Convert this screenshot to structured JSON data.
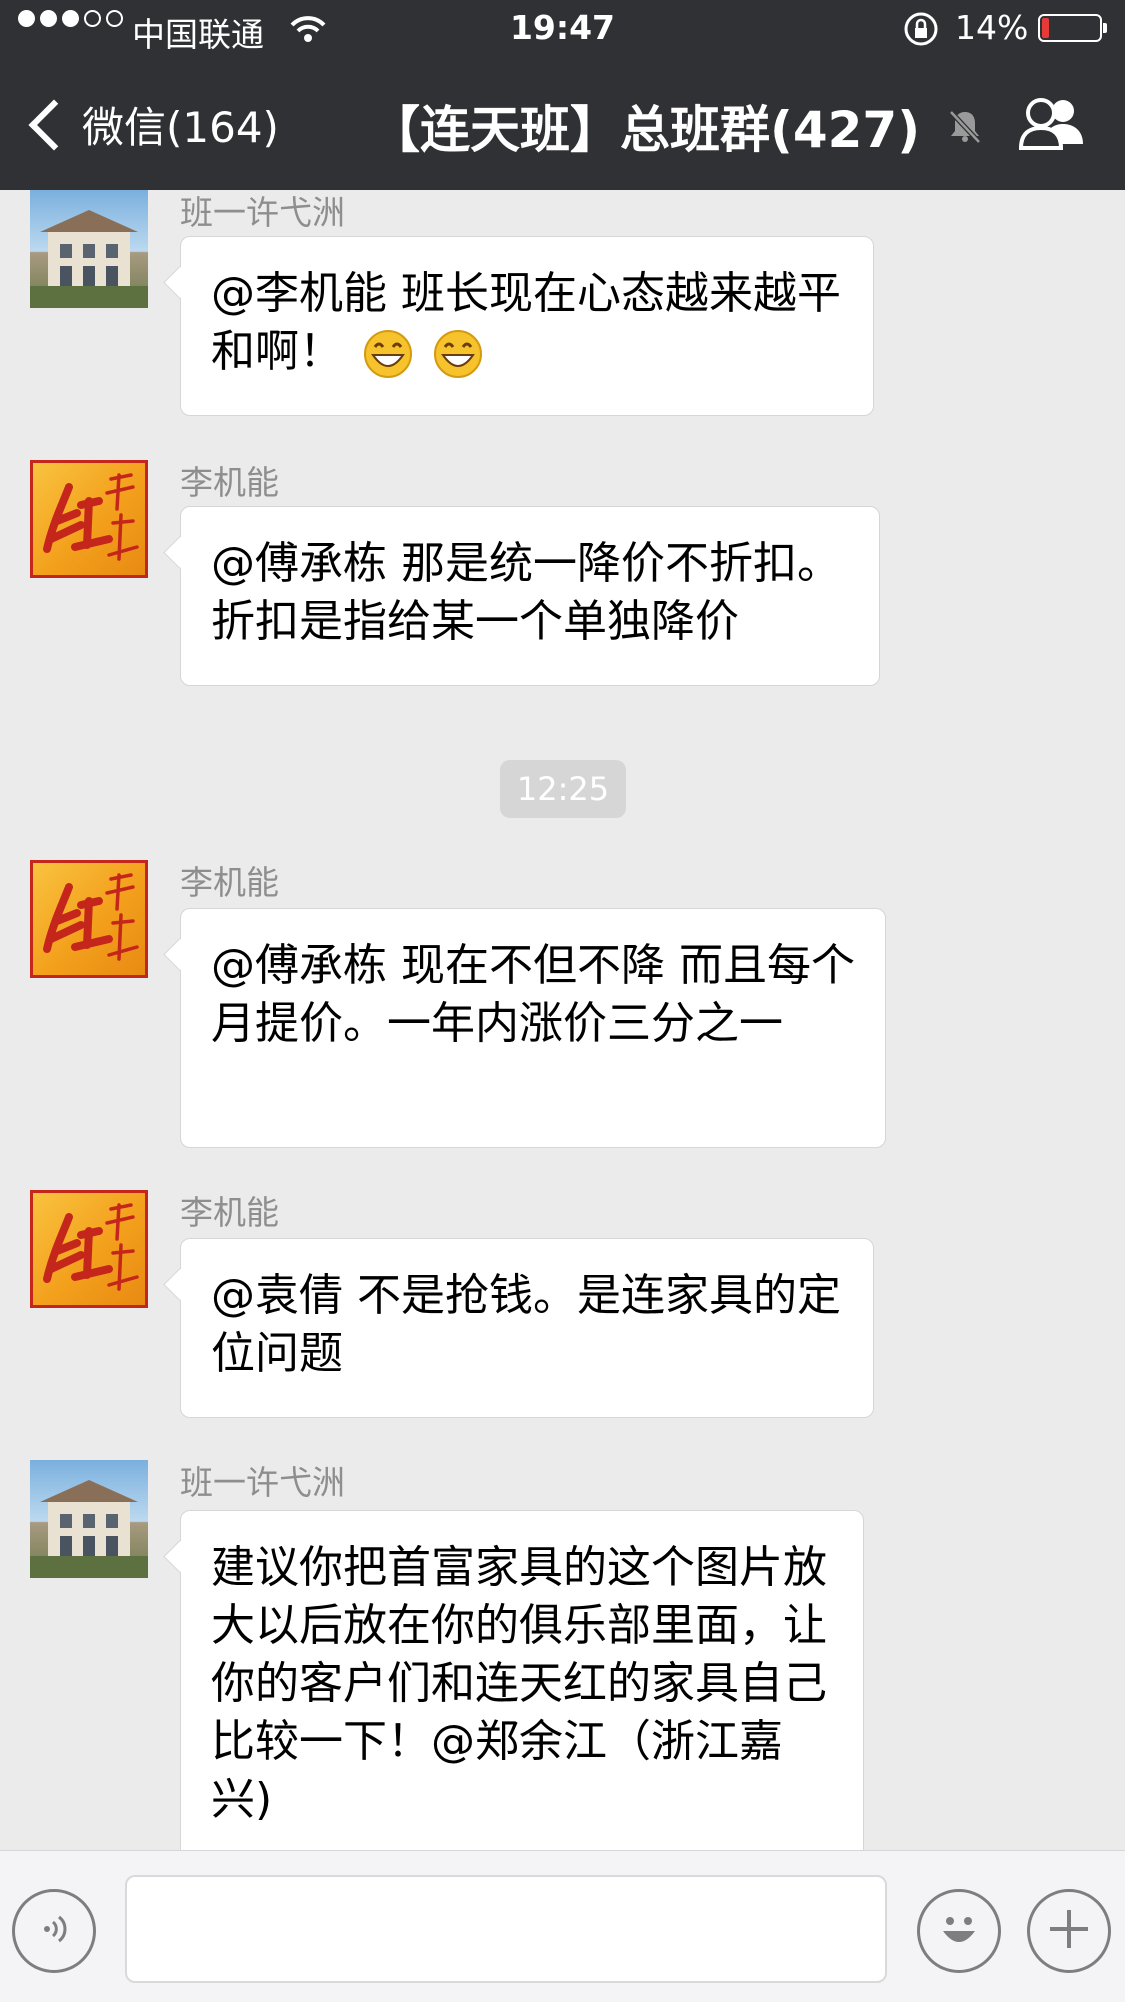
{
  "status_bar": {
    "carrier": "中国联通",
    "time": "19:47",
    "battery_percent": "14%",
    "battery_level": 0.14,
    "colors": {
      "battery_low": "#e73a36"
    }
  },
  "nav": {
    "back_label": "微信(164)",
    "title": "【连天班】总班群(427)",
    "icons": {
      "back": "chevron-left-icon",
      "mute": "mute-bell-icon",
      "members": "group-members-icon"
    }
  },
  "messages": [
    {
      "sender": "班一许弋洲",
      "avatar": "house-avatar",
      "text": "@李机能 班长现在心态越来越平和啊！",
      "emojis": 2
    },
    {
      "sender": "李机能",
      "avatar": "hong-logo-avatar",
      "text": "@傅承栋 那是统一降价不折扣。 折扣是指给某一个单独降价"
    },
    {
      "sender": "李机能",
      "avatar": "hong-logo-avatar",
      "text": "@傅承栋 现在不但不降 而且每个月提价。一年内涨价三分之一"
    },
    {
      "sender": "李机能",
      "avatar": "hong-logo-avatar",
      "text": "@袁倩 不是抢钱。是连家具的定位问题"
    },
    {
      "sender": "班一许弋洲",
      "avatar": "house-avatar",
      "text": "建议你把首富家具的这个图片放大以后放在你的俱乐部里面，让你的客户们和连天红的家具自己比较一下！@郑余江（浙江嘉兴)"
    }
  ],
  "time_divider": "12:25",
  "input_bar": {
    "icons": {
      "voice": "voice-icon",
      "emoji": "emoji-icon",
      "more": "plus-icon"
    }
  },
  "colors": {
    "header_bg": "#303134",
    "chat_bg": "#ebebeb",
    "bubble_bg": "#ffffff"
  }
}
